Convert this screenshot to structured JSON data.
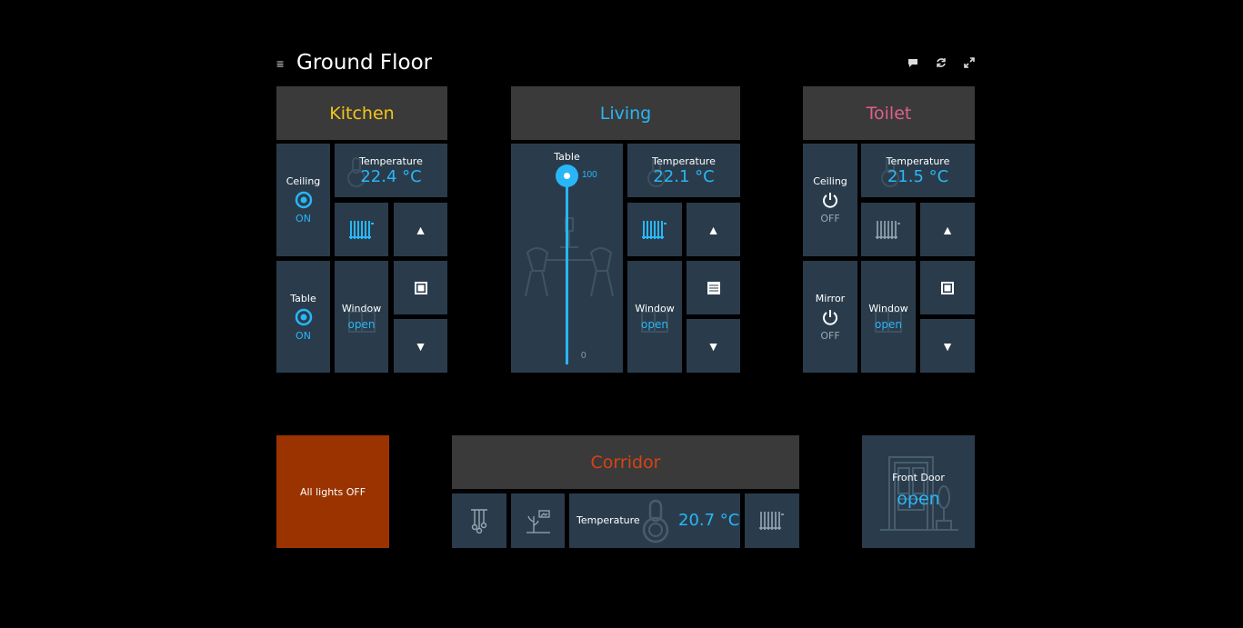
{
  "page": {
    "title": "Ground Floor"
  },
  "toolbar": {
    "menu_icon": "menu-icon",
    "chat_icon": "chat-icon",
    "refresh_icon": "refresh-icon",
    "fullscreen_icon": "fullscreen-icon"
  },
  "kitchen": {
    "name": "Kitchen",
    "color": "#f5c518",
    "ceiling": {
      "label": "Ceiling",
      "state": "ON"
    },
    "table": {
      "label": "Table",
      "state": "ON"
    },
    "temperature": {
      "label": "Temperature",
      "value": "22.4 °C"
    },
    "window": {
      "label": "Window",
      "state": "open"
    }
  },
  "living": {
    "name": "Living",
    "color": "#29b6f6",
    "table": {
      "label": "Table",
      "max": "100",
      "min": "0",
      "level": 100
    },
    "temperature": {
      "label": "Temperature",
      "value": "22.1 °C"
    },
    "window": {
      "label": "Window",
      "state": "open"
    }
  },
  "toilet": {
    "name": "Toilet",
    "color": "#e0608a",
    "ceiling": {
      "label": "Ceiling",
      "state": "OFF"
    },
    "mirror": {
      "label": "Mirror",
      "state": "OFF"
    },
    "temperature": {
      "label": "Temperature",
      "value": "21.5 °C"
    },
    "window": {
      "label": "Window",
      "state": "open"
    }
  },
  "all_lights": {
    "label": "All lights OFF",
    "color": "#9a3300"
  },
  "corridor": {
    "name": "Corridor",
    "color": "#d84315",
    "temperature": {
      "label": "Temperature",
      "value": "20.7 °C"
    }
  },
  "front_door": {
    "label": "Front Door",
    "state": "open"
  }
}
